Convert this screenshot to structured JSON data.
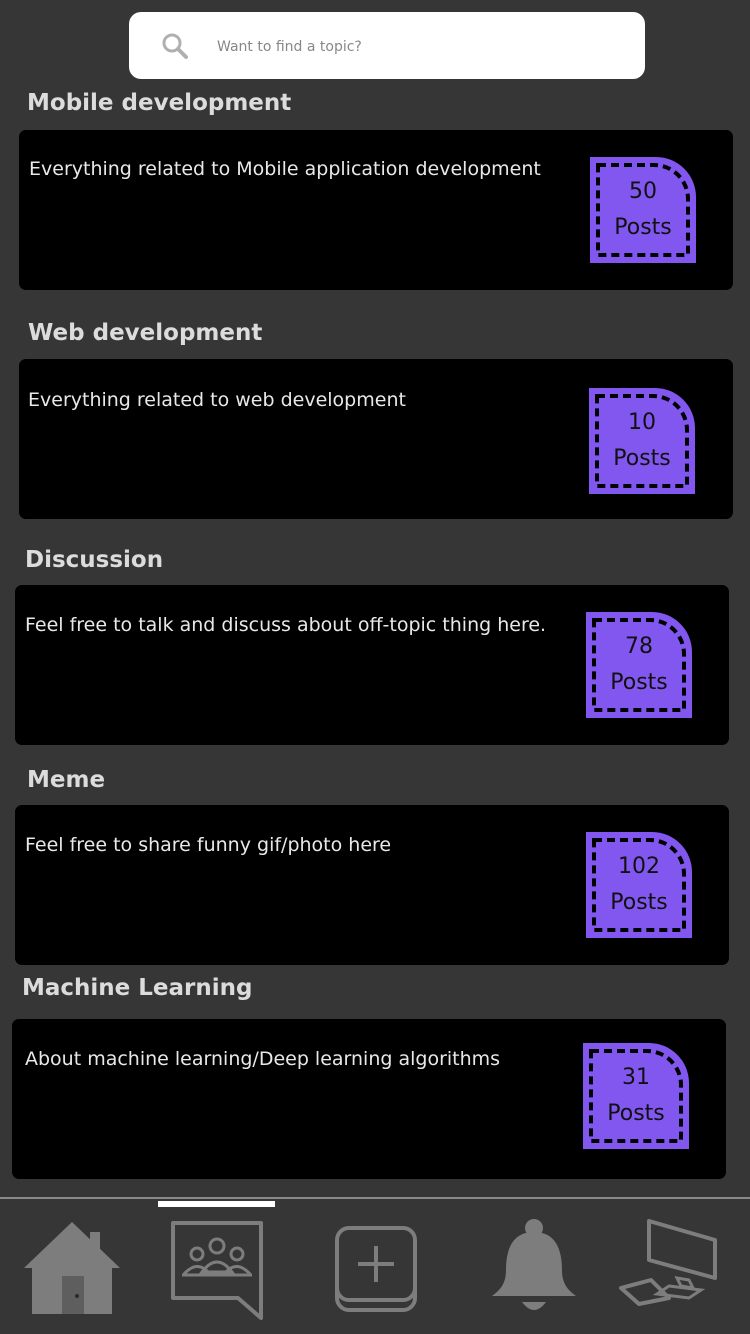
{
  "search": {
    "placeholder": "Want to find a topic?"
  },
  "topics": [
    {
      "title": "Mobile development",
      "description": "Everything related to Mobile application development",
      "count": "50",
      "count_label": "Posts"
    },
    {
      "title": "Web development",
      "description": "Everything related to web development",
      "count": "10",
      "count_label": "Posts"
    },
    {
      "title": "Discussion",
      "description": "Feel free to talk and discuss about off-topic thing here.",
      "count": "78",
      "count_label": "Posts"
    },
    {
      "title": "Meme",
      "description": "Feel free to share funny gif/photo here",
      "count": "102",
      "count_label": "Posts"
    },
    {
      "title": "Machine Learning",
      "description": "About machine learning/Deep learning algorithms",
      "count": "31",
      "count_label": "Posts"
    }
  ],
  "bottom_nav": {
    "items": [
      {
        "icon": "home-icon"
      },
      {
        "icon": "community-chat-icon",
        "active": true
      },
      {
        "icon": "add-post-icon"
      },
      {
        "icon": "bell-icon"
      },
      {
        "icon": "computer-icon"
      }
    ]
  },
  "colors": {
    "background": "#363636",
    "card": "#000000",
    "badge": "#8257f0",
    "icon": "#7d7d7d"
  }
}
